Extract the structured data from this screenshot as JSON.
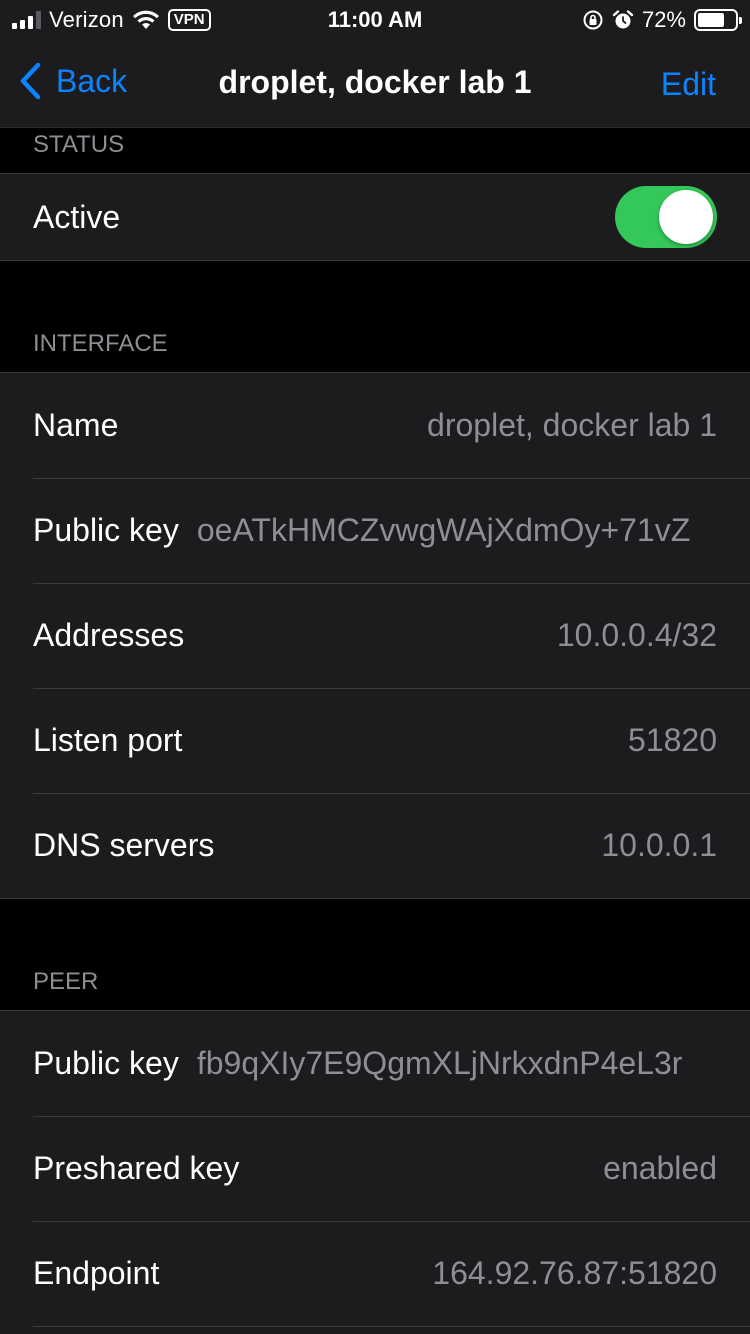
{
  "status_bar": {
    "carrier": "Verizon",
    "vpn_label": "VPN",
    "time": "11:00 AM",
    "battery_percent": "72%",
    "battery_level": 0.72
  },
  "nav": {
    "back_label": "Back",
    "title": "droplet, docker lab 1",
    "edit_label": "Edit"
  },
  "status_section": {
    "header": "STATUS",
    "active_label": "Active",
    "active_on": true
  },
  "interface_section": {
    "header": "INTERFACE",
    "rows": [
      {
        "label": "Name",
        "value": "droplet, docker lab 1"
      },
      {
        "label": "Public key",
        "value": "oeATkHMCZvwgWAjXdmOy+71vZ"
      },
      {
        "label": "Addresses",
        "value": "10.0.0.4/32"
      },
      {
        "label": "Listen port",
        "value": "51820"
      },
      {
        "label": "DNS servers",
        "value": "10.0.0.1"
      }
    ]
  },
  "peer_section": {
    "header": "PEER",
    "rows": [
      {
        "label": "Public key",
        "value": "fb9qXIy7E9QgmXLjNrkxdnP4eL3r"
      },
      {
        "label": "Preshared key",
        "value": "enabled"
      },
      {
        "label": "Endpoint",
        "value": "164.92.76.87:51820"
      }
    ]
  },
  "colors": {
    "accent": "#0a84ff",
    "toggle_on": "#34c759",
    "cell_bg": "#1c1c1e",
    "secondary_text": "#8e8e93"
  }
}
